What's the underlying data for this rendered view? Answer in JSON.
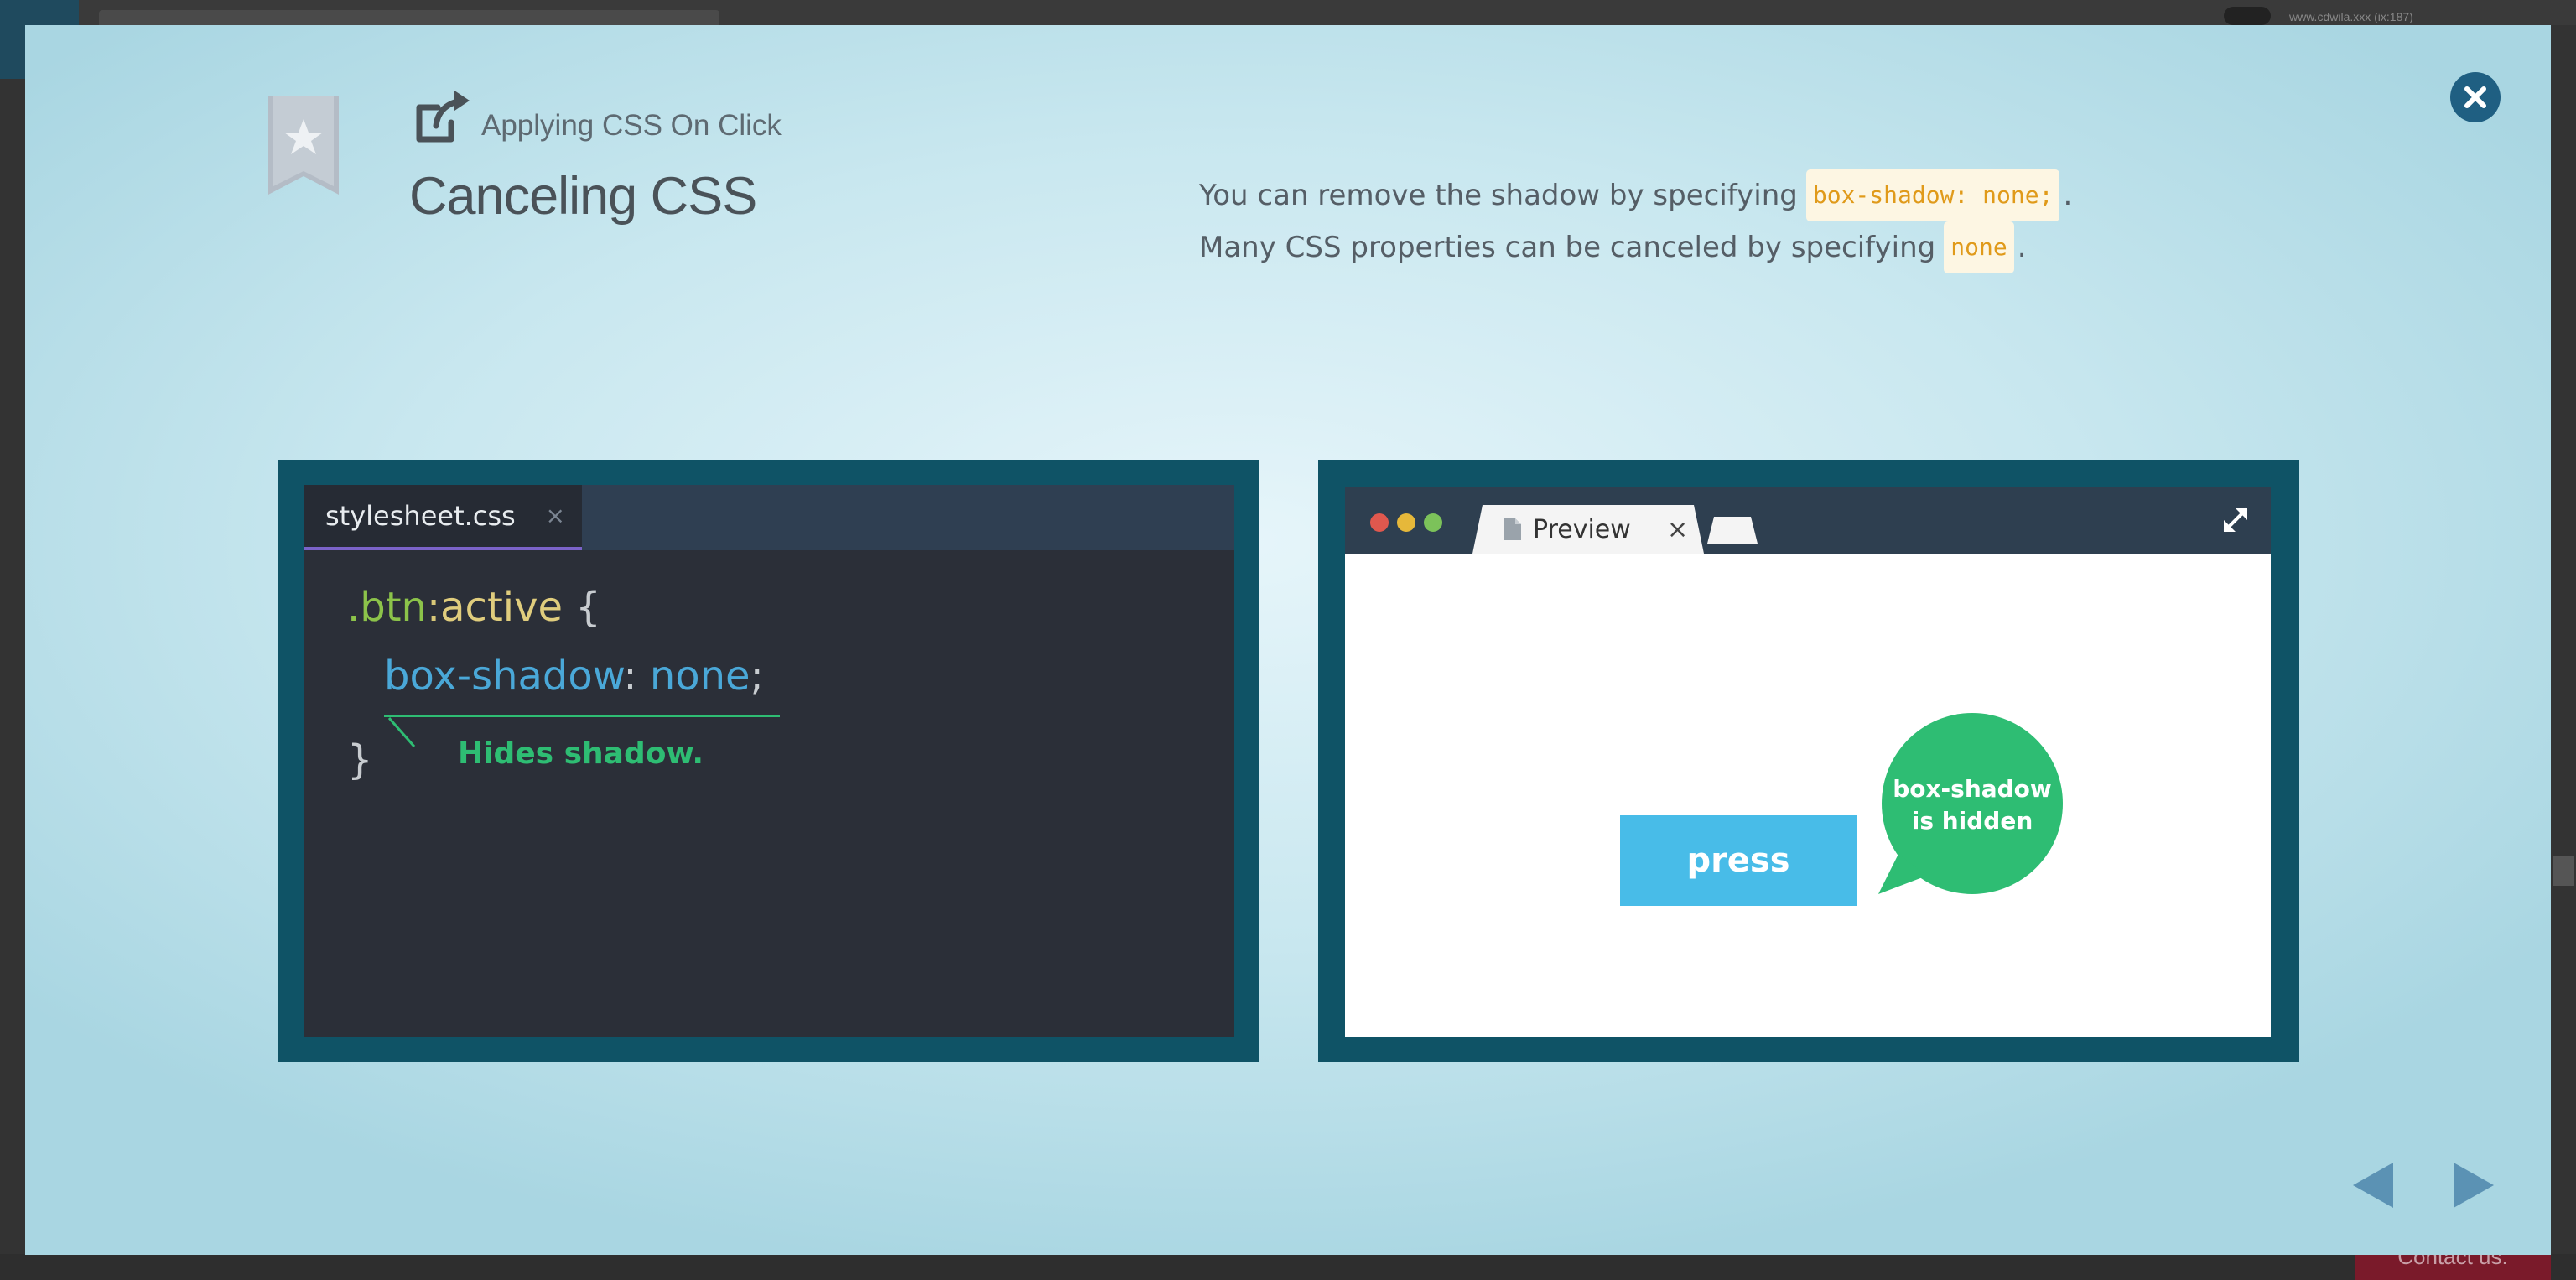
{
  "background": {
    "url_text": "www.cdwila.xxx (ix:187)",
    "contact_label": "Contact us."
  },
  "header": {
    "subtitle": "Applying CSS On Click",
    "title": "Canceling CSS",
    "icons": [
      "bookmark-star-icon",
      "external-link-icon",
      "close-icon"
    ]
  },
  "description": {
    "line1_before": "You can remove the shadow by specifying",
    "line1_code": "box-shadow: none;",
    "line1_after": ".",
    "line2_before": "Many CSS properties can be canceled by specifying",
    "line2_code": "none",
    "line2_after": "."
  },
  "editor": {
    "tab_label": "stylesheet.css",
    "tab_close": "×",
    "code": {
      "selector": ".btn",
      "pseudo_colon": ":",
      "pseudo": "active",
      "open_brace": " {",
      "property": "box-shadow",
      "colon": ": ",
      "value": "none",
      "semicolon": ";",
      "close_brace": "}"
    },
    "annotation": "Hides shadow."
  },
  "preview": {
    "tab_label": "Preview",
    "tab_close": "×",
    "button_label": "press",
    "bubble_line1": "box-shadow",
    "bubble_line2": "is hidden"
  },
  "colors": {
    "panel_frame": "#0f5366",
    "editor_bg": "#2b2f38",
    "accent_green": "#2ebd73",
    "button_blue": "#48bce8",
    "code_highlight": "#e09a1a"
  }
}
